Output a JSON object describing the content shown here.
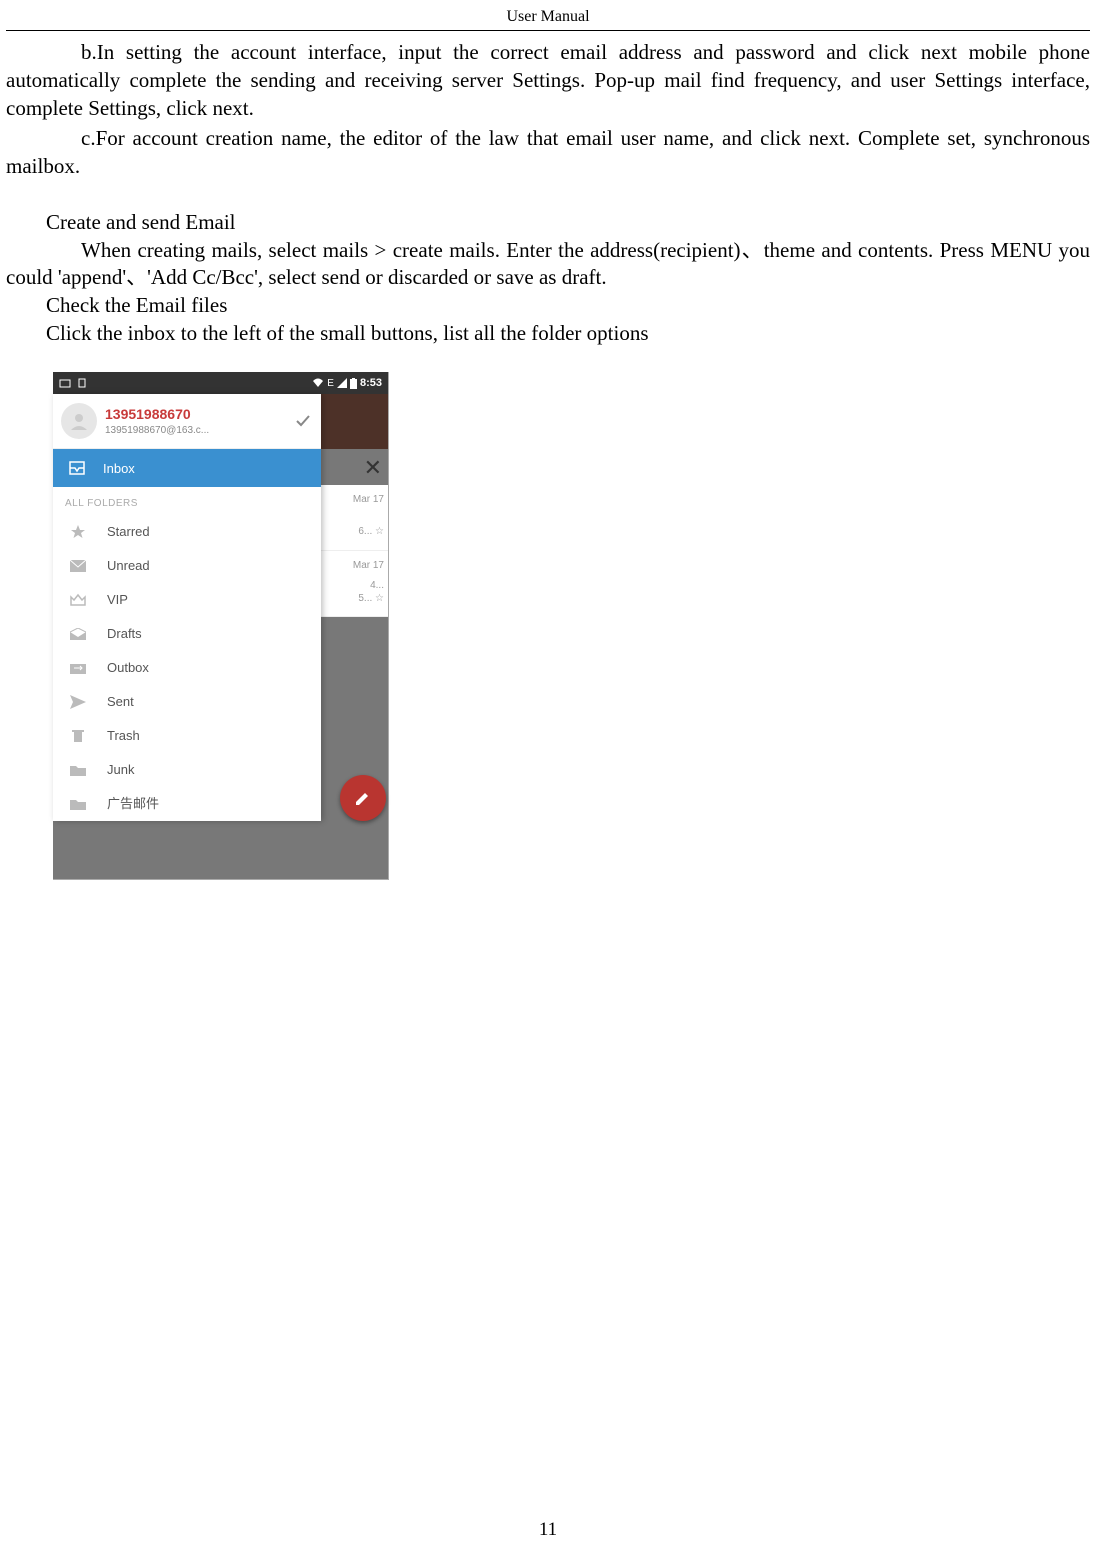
{
  "header": {
    "title": "User    Manual"
  },
  "body": {
    "p_b": "b.In  setting  the  account  interface,  input  the  correct  email  address  and  password  and  click  next mobile phone automatically complete the sending and receiving server Settings. Pop-up mail find frequency, and user Settings interface, complete Settings, click next.",
    "p_c": "c.For account creation name, the editor of the law that email user name, and click next. Complete set, synchronous mailbox.",
    "h_create": "Create and send Email",
    "p_create": "When creating mails, select mails > create mails. Enter the address(recipient)、theme and contents. Press MENU you could 'append'、'Add Cc/Bcc',    select send or discarded or save as draft.",
    "h_check": "Check the Email files",
    "p_check": "Click the inbox to the left of the small buttons, list all the folder options"
  },
  "phone": {
    "status": {
      "time": "8:53",
      "net": "E",
      "wifi": "▾"
    },
    "account": {
      "name": "13951988670",
      "email": "13951988670@163.c..."
    },
    "inbox_label": "Inbox",
    "section": "ALL FOLDERS",
    "folders": [
      {
        "icon": "star",
        "label": "Starred"
      },
      {
        "icon": "mail",
        "label": "Unread"
      },
      {
        "icon": "crown",
        "label": " VIP"
      },
      {
        "icon": "drafts",
        "label": "Drafts"
      },
      {
        "icon": "outbox",
        "label": "Outbox"
      },
      {
        "icon": "sent",
        "label": "Sent"
      },
      {
        "icon": "trash",
        "label": "Trash"
      },
      {
        "icon": "folder",
        "label": "Junk"
      },
      {
        "icon": "folder",
        "label": "广告邮件"
      }
    ],
    "bg": {
      "date1": "Mar 17",
      "tail1": "6... ☆",
      "date2": "Mar 17",
      "tail2a": "4...",
      "tail2b": "5... ☆"
    }
  },
  "footer": {
    "page": "11"
  }
}
